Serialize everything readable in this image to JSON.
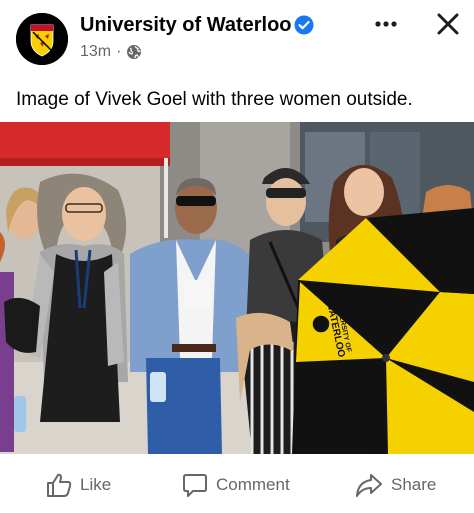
{
  "post": {
    "page_name": "University of Waterloo",
    "timestamp": "13m",
    "separator": "·",
    "audience_icon": "globe-icon",
    "verified_icon": "verified-badge-icon",
    "caption": "Image of Vivek Goel with three women outside."
  },
  "photo": {
    "alt": "Image of Vivek Goel with three women outside.",
    "umbrella_text": [
      "UNIVERSITY OF",
      "WATERLOO"
    ],
    "umbrella_colors": {
      "yellow": "#f5d100",
      "black": "#111111"
    },
    "tent_color": "#d62a2a"
  },
  "actions": {
    "like": {
      "label": "Like",
      "icon": "thumbs-up-icon"
    },
    "comment": {
      "label": "Comment",
      "icon": "speech-bubble-icon"
    },
    "share": {
      "label": "Share",
      "icon": "share-arrow-icon"
    }
  },
  "colors": {
    "verified": "#1877f2",
    "secondary_text": "#65676b",
    "primary_text": "#050505"
  }
}
